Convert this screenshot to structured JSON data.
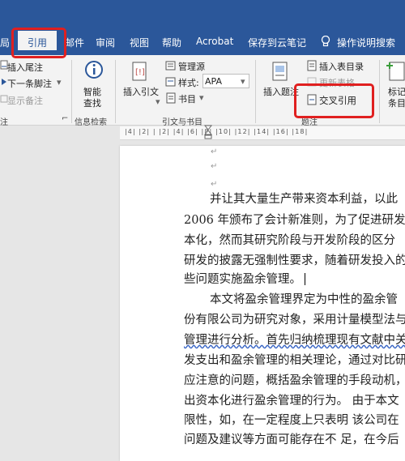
{
  "ribbon_tabs": [
    "局",
    "引用",
    "邮件",
    "审阅",
    "视图",
    "帮助",
    "Acrobat",
    "保存到云笔记",
    "操作说明搜索"
  ],
  "ribbon": {
    "footnotes": {
      "insert_endnote": "插入尾注",
      "next_footnote": "下一条脚注",
      "show_notes": "显示备注",
      "group_label": "注"
    },
    "research": {
      "smart_lookup": "智能",
      "smart_lookup2": "查找",
      "group_label": "信息检索"
    },
    "citations": {
      "insert_citation": "插入引文",
      "manage_sources": "管理源",
      "style_label": "样式:",
      "style_value": "APA",
      "bibliography": "书目",
      "group_label": "引文与书目"
    },
    "captions": {
      "insert_caption": "插入题注",
      "insert_table_of_figures": "插入表目录",
      "update_table": "更新表格",
      "cross_reference": "交叉引用",
      "group_label": "题注"
    },
    "index": {
      "mark_entry": "标记",
      "mark_entry2": "条目"
    }
  },
  "ruler_text": "|4|  |2|  |  |2|  |4|  |6|  |8|  |10|  |12|  |14|  |16|  |18|",
  "document": {
    "para1": [
      "并让其大量生产带来资本利益，以此",
      "2006 年颁布了会计新准则，为了促进研发",
      "本化，然而其研究阶段与开发阶段的区分",
      "研发的披露无强制性要求，随着研发投入的",
      "些问题实施盈余管理。"
    ],
    "para2": [
      "本文将盈余管理界定为中性的盈余管",
      "份有限公司为研究对象，采用计量模型法与",
      "管理进行分析。首先归纳梳理现有文献中关",
      "发支出和盈余管理的相关理论，通过对比研",
      "应注意的问题，概括盈余管理的手段动机，研",
      "出资本化进行盈余管理的行为。  由于本文",
      "限性，如，在一定程度上只表明  该公司在",
      "问题及建议等方面可能存在不  足，在今后"
    ],
    "para_mark": "↵"
  }
}
